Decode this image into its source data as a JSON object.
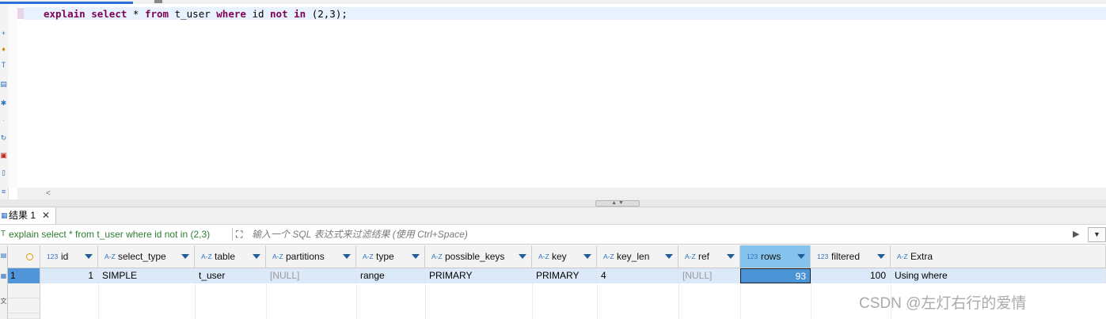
{
  "editor": {
    "sql_keyword_1": "explain",
    "sql_keyword_2": "select",
    "sql_text_1": " * ",
    "sql_keyword_3": "from",
    "sql_text_2": " t_user ",
    "sql_keyword_4": "where",
    "sql_text_3": " id ",
    "sql_keyword_5": "not",
    "sql_text_4": " ",
    "sql_keyword_6": "in",
    "sql_text_5": " (2,3);"
  },
  "results_tab": {
    "label": "结果 1",
    "close": "✕"
  },
  "filter_bar": {
    "query": "explain select * from t_user where id not in (2,3)",
    "placeholder": "输入一个 SQL 表达式来过滤结果 (使用 Ctrl+Space)"
  },
  "grid": {
    "columns": [
      {
        "type_badge": "123",
        "name": "id"
      },
      {
        "type_badge": "A-Z",
        "name": "select_type"
      },
      {
        "type_badge": "A-Z",
        "name": "table"
      },
      {
        "type_badge": "A-Z",
        "name": "partitions"
      },
      {
        "type_badge": "A-Z",
        "name": "type"
      },
      {
        "type_badge": "A-Z",
        "name": "possible_keys"
      },
      {
        "type_badge": "A-Z",
        "name": "key"
      },
      {
        "type_badge": "A-Z",
        "name": "key_len"
      },
      {
        "type_badge": "A-Z",
        "name": "ref"
      },
      {
        "type_badge": "123",
        "name": "rows"
      },
      {
        "type_badge": "123",
        "name": "filtered"
      },
      {
        "type_badge": "A-Z",
        "name": "Extra"
      }
    ],
    "rows": [
      {
        "row_number": "1",
        "cells": [
          "1",
          "SIMPLE",
          "t_user",
          "[NULL]",
          "range",
          "PRIMARY",
          "PRIMARY",
          "4",
          "[NULL]",
          "93",
          "100",
          "Using where"
        ]
      }
    ]
  },
  "watermark": "CSDN @左灯右行的爱情",
  "colors": {
    "keyword": "#7f0055",
    "selected_header": "#86c3ec",
    "selected_cell": "#4a93d6",
    "row_highlight": "#dbe9f8",
    "query_green": "#2e7d32"
  }
}
